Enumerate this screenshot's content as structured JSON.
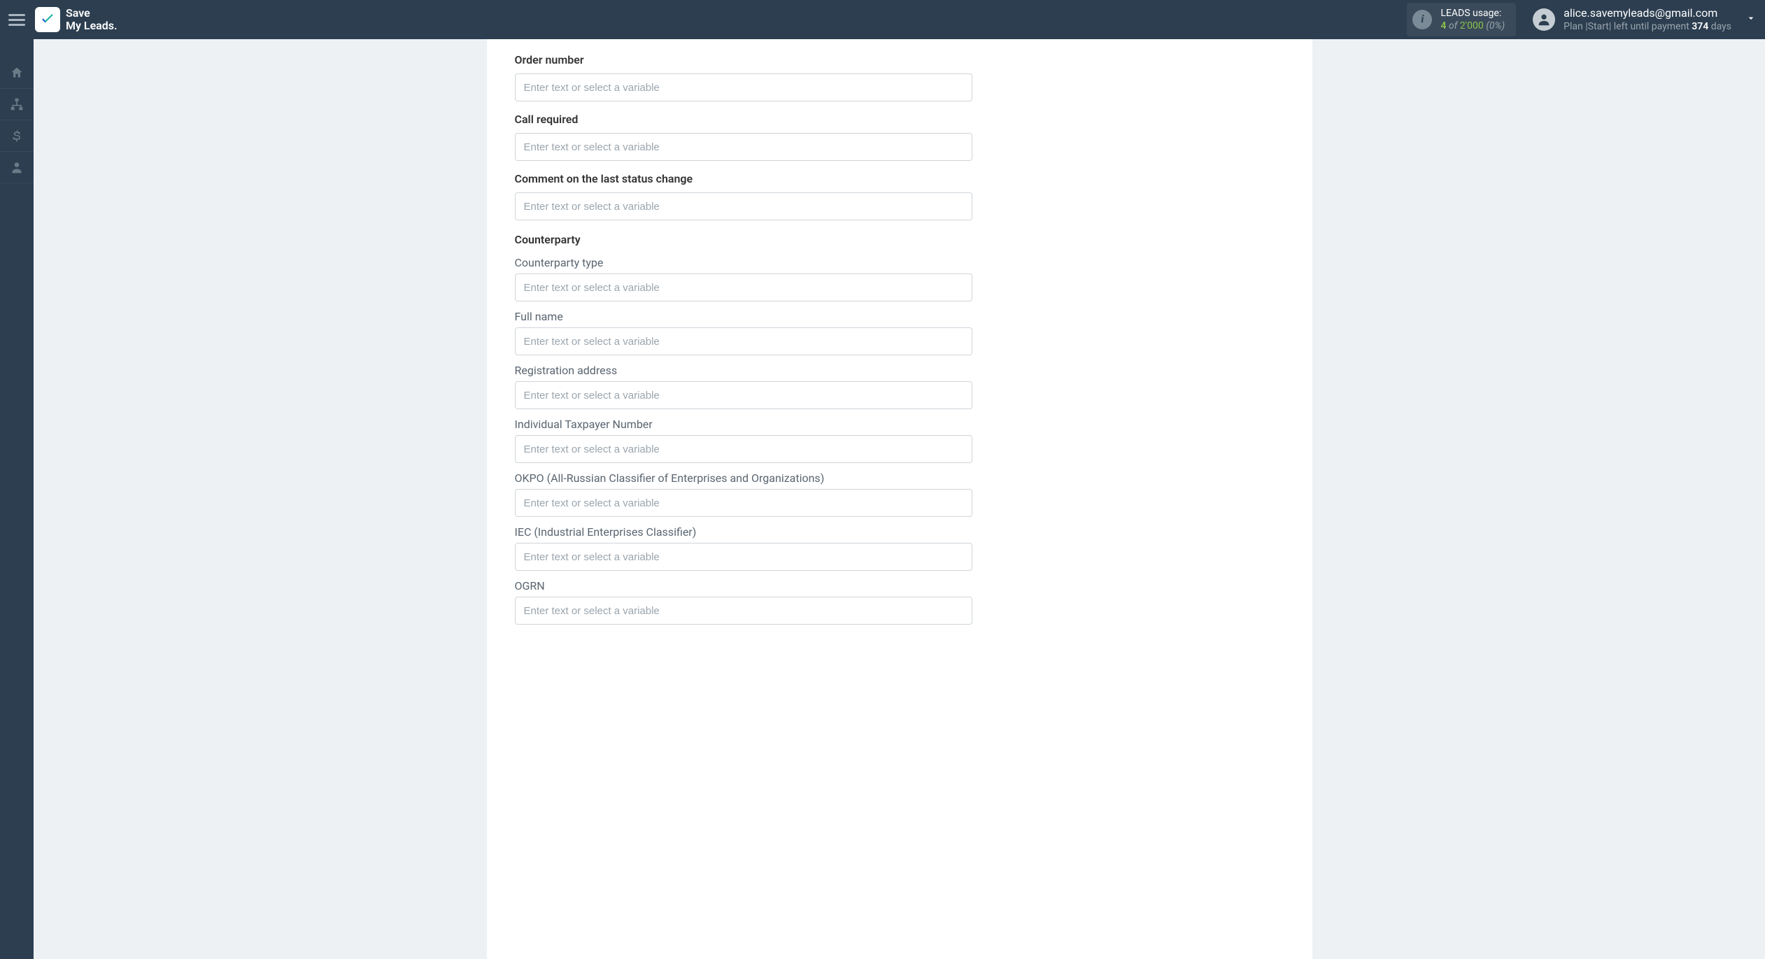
{
  "header": {
    "logo_line1": "Save",
    "logo_line2": "My Leads.",
    "leads_label": "LEADS usage:",
    "leads_used": "4",
    "leads_of": "of",
    "leads_total": "2'000",
    "leads_pct": "(0%)",
    "user_email": "alice.savemyleads@gmail.com",
    "plan_prefix": "Plan |",
    "plan_name": "Start",
    "plan_suffix": "| left until payment ",
    "plan_days": "374",
    "plan_days_label": " days"
  },
  "form": {
    "placeholder": "Enter text or select a variable",
    "fields": [
      {
        "label": "Order number",
        "bold": true
      },
      {
        "label": "Call required",
        "bold": true
      },
      {
        "label": "Comment on the last status change",
        "bold": true
      }
    ],
    "section_title": "Counterparty",
    "subfields": [
      {
        "label": "Counterparty type"
      },
      {
        "label": "Full name"
      },
      {
        "label": "Registration address"
      },
      {
        "label": "Individual Taxpayer Number"
      },
      {
        "label": "OKPO (All-Russian Classifier of Enterprises and Organizations)"
      },
      {
        "label": "IEC (Industrial Enterprises Classifier)"
      },
      {
        "label": "OGRN"
      }
    ]
  }
}
